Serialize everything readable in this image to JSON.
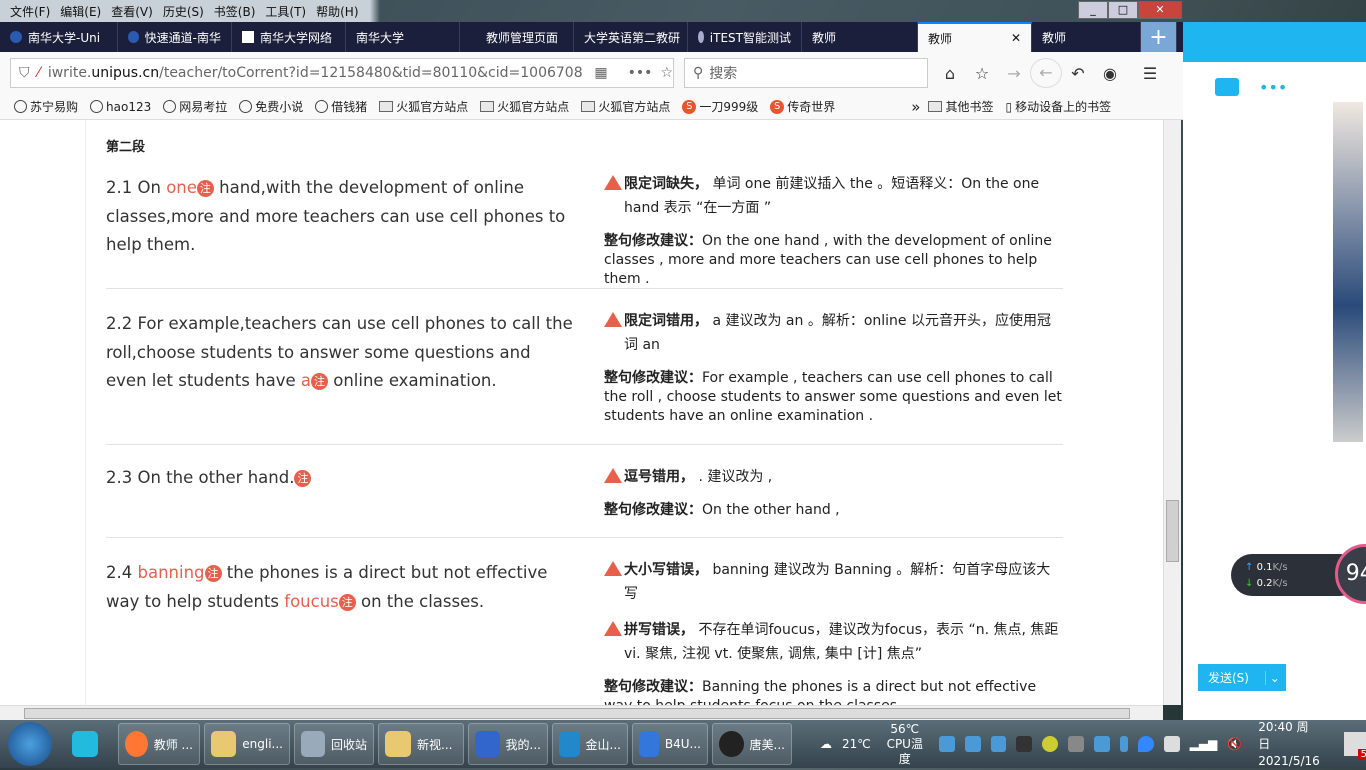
{
  "menu": [
    "文件(F)",
    "编辑(E)",
    "查看(V)",
    "历史(S)",
    "书签(B)",
    "工具(T)",
    "帮助(H)"
  ],
  "tabs": [
    {
      "label": "南华大学-Uni"
    },
    {
      "label": "快速通道-南华"
    },
    {
      "label": "南华大学网络"
    },
    {
      "label": "南华大学"
    },
    {
      "label": "教师管理页面"
    },
    {
      "label": "大学英语第二教研"
    },
    {
      "label": "iTEST智能测试"
    },
    {
      "label": "教师"
    },
    {
      "label": "教师",
      "active": true
    },
    {
      "label": "教师"
    }
  ],
  "newtab": "+",
  "url": {
    "pre": "iwrite.",
    "host": "unipus.cn",
    "path": "/teacher/toCorrent?id=12158480&tid=80110&cid=1006708"
  },
  "search_placeholder": "搜索",
  "bookmarks": [
    {
      "label": "苏宁易购",
      "icon": "globe"
    },
    {
      "label": "hao123",
      "icon": "globe"
    },
    {
      "label": "网易考拉",
      "icon": "globe"
    },
    {
      "label": "免费小说",
      "icon": "globe"
    },
    {
      "label": "借钱猪",
      "icon": "globe"
    },
    {
      "label": "火狐官方站点",
      "icon": "folder"
    },
    {
      "label": "火狐官方站点",
      "icon": "folder"
    },
    {
      "label": "火狐官方站点",
      "icon": "folder"
    },
    {
      "label": "一刀999级",
      "icon": "sogou"
    },
    {
      "label": "传奇世界",
      "icon": "sogou"
    }
  ],
  "bookmarks_right": [
    "其他书签",
    "移动设备上的书签"
  ],
  "section": "第二段",
  "mark": "注",
  "suggest_label": "整句修改建议：",
  "rows": [
    {
      "pre": "2.1   On ",
      "err1": "one",
      "post": " hand,with the development of online classes,more and more teachers can use cell phones to help them.",
      "issues": [
        {
          "title": "限定词缺失，",
          "text": " 单词 one 前建议插入 the 。短语释义：On the one hand 表示 “在一方面 ”"
        }
      ],
      "suggestion": "On the one hand , with the development of online classes , more and more teachers can use cell phones to help them ."
    },
    {
      "pre": "2.2 For example,teachers can use cell phones to call the roll,choose students to answer some questions and even let students have ",
      "err1": "a",
      "post": " online examination.",
      "issues": [
        {
          "title": "限定词错用，",
          "text": " a 建议改为 an 。解析：online 以元音开头，应使用冠词 an"
        }
      ],
      "suggestion": "For example , teachers can use cell phones to call the roll , choose students to answer some questions and even let students have an online examination ."
    },
    {
      "pre": "2.3 On the other hand.",
      "issues": [
        {
          "title": "逗号错用，",
          "text": " . 建议改为 ,"
        }
      ],
      "suggestion": "On the other hand ,"
    },
    {
      "pre": "2.4 ",
      "err1": "banning",
      "mid": " the phones is a direct but not effective way to help students ",
      "err2": "foucus",
      "post": " on the classes.",
      "issues": [
        {
          "title": "大小写错误，",
          "text": " banning 建议改为 Banning 。解析：句首字母应该大写"
        },
        {
          "title": "拼写错误，",
          "text": " 不存在单词foucus，建议改为focus，表示 “n. 焦点, 焦距 vi. 聚焦, 注视 vt. 使聚焦, 调焦, 集中 [计] 焦点”"
        }
      ],
      "suggestion": "Banning the phones is a direct but not effective way to help students focus on the classes ."
    }
  ],
  "qq": {
    "send": "发送(S)",
    "up": "0.1",
    "down": "0.2",
    "unit": "K/s",
    "gauge": "94",
    "gauge_unit": "%"
  },
  "taskbar": [
    "教师 ...",
    "engli...",
    "回收站",
    "新视...",
    "我的...",
    "金山...",
    "B4U...",
    "唐美..."
  ],
  "tray": {
    "weather": "21℃",
    "cpu_temp": "56℃",
    "cpu_label": "CPU温度",
    "time": "20:40 周日",
    "date": "2021/5/16",
    "badge": "5"
  },
  "colors": {
    "error": "#e8604c",
    "tabbar": "#1c1f3b",
    "qq": "#1fb5f0"
  }
}
